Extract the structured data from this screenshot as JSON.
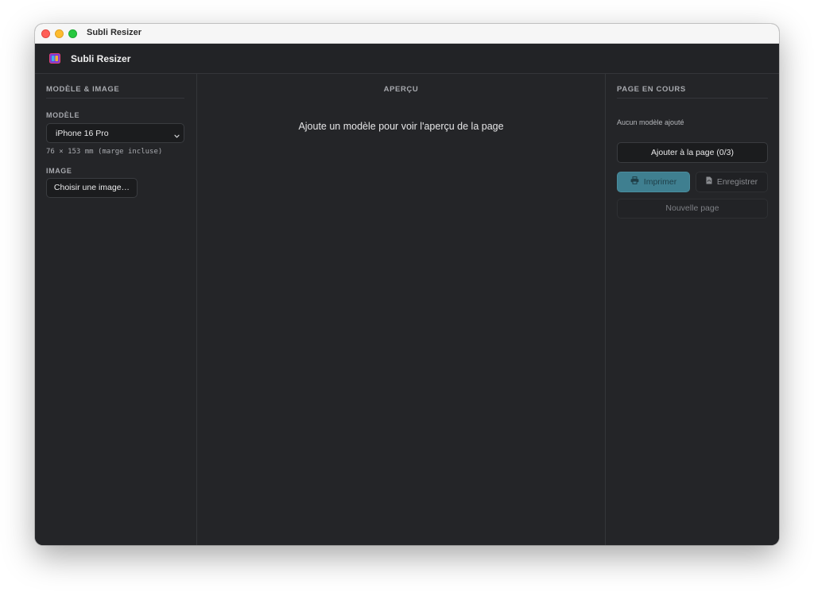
{
  "window": {
    "title": "Subli Resizer"
  },
  "header": {
    "app_name": "Subli Resizer"
  },
  "left_panel": {
    "section_title": "MODÈLE & IMAGE",
    "model_label": "MODÈLE",
    "model_selected": "iPhone 16 Pro",
    "model_dimensions": "76 × 153 mm (marge incluse)",
    "image_label": "IMAGE",
    "choose_image_button": "Choisir une image…"
  },
  "center_panel": {
    "section_title": "APERÇU",
    "empty_message": "Ajoute un modèle pour voir l'aperçu de la page"
  },
  "right_panel": {
    "section_title": "PAGE EN COURS",
    "status_message": "Aucun modèle ajouté",
    "add_to_page_button": "Ajouter à la page (0/3)",
    "print_button": "Imprimer",
    "save_button": "Enregistrer",
    "new_page_button": "Nouvelle page"
  },
  "icons": {
    "app_logo": "app-logo-icon",
    "select_chevron": "chevron-down-icon",
    "print": "printer-icon",
    "save": "pdf-file-icon"
  },
  "colors": {
    "background": "#232427",
    "accent": "#3f7f90",
    "text": "#e9e9ea",
    "muted_text": "#a7a9ae"
  }
}
